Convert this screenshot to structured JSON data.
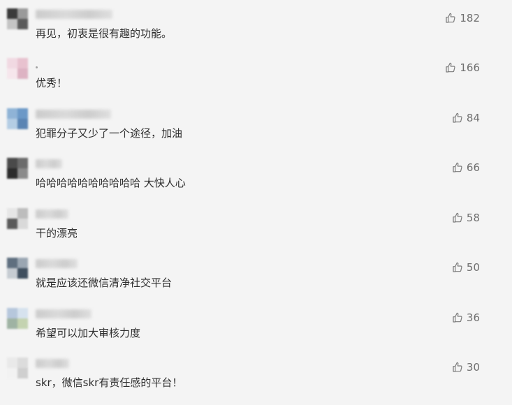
{
  "comments": [
    {
      "text": "再见，初衷是很有趣的功能。",
      "likes": "182",
      "avatar_colors": [
        "#3a3a3a",
        "#9a9a9a",
        "#c4c4c4",
        "#5a5a5a"
      ],
      "nickname_blurred": true
    },
    {
      "text": "优秀！",
      "likes": "166",
      "avatar_colors": [
        "#f1d9e2",
        "#e8c2cf",
        "#f6e6ec",
        "#ddb3c3"
      ],
      "nickname_blurred": false
    },
    {
      "text": "犯罪分子又少了一个途径，加油",
      "likes": "84",
      "avatar_colors": [
        "#8fb3d6",
        "#6b98c7",
        "#b4cde4",
        "#5a84b3"
      ],
      "nickname_blurred": true
    },
    {
      "text": "哈哈哈哈哈哈哈哈哈哈 大快人心",
      "likes": "66",
      "avatar_colors": [
        "#4a4a4a",
        "#6b6b6b",
        "#2b2b2b",
        "#8a8a8a"
      ],
      "nickname_blurred": true
    },
    {
      "text": "干的漂亮",
      "likes": "58",
      "avatar_colors": [
        "#e6e6e6",
        "#bdbdbd",
        "#5a5a5a",
        "#d9d9d9"
      ],
      "nickname_blurred": true
    },
    {
      "text": "就是应该还微信清净社交平台",
      "likes": "50",
      "avatar_colors": [
        "#5f6f7f",
        "#9aa6b2",
        "#c6ccd2",
        "#3f4f5f"
      ],
      "nickname_blurred": true
    },
    {
      "text": "希望可以加大审核力度",
      "likes": "36",
      "avatar_colors": [
        "#b6c7dc",
        "#d6e2ee",
        "#9fb3a3",
        "#c4d3b0"
      ],
      "nickname_blurred": true
    },
    {
      "text": "skr，微信skr有责任感的平台！",
      "likes": "30",
      "avatar_colors": [
        "#e9e9e9",
        "#dcdcdc",
        "#f2f2f2",
        "#cfcfcf"
      ],
      "nickname_blurred": true
    }
  ],
  "icons": {
    "like": "thumbs-up-icon"
  },
  "colors": {
    "background": "#f4f4f4",
    "text": "#2e2e2e",
    "like_count": "#6f6f6f",
    "like_icon": "#7a7a7a"
  }
}
